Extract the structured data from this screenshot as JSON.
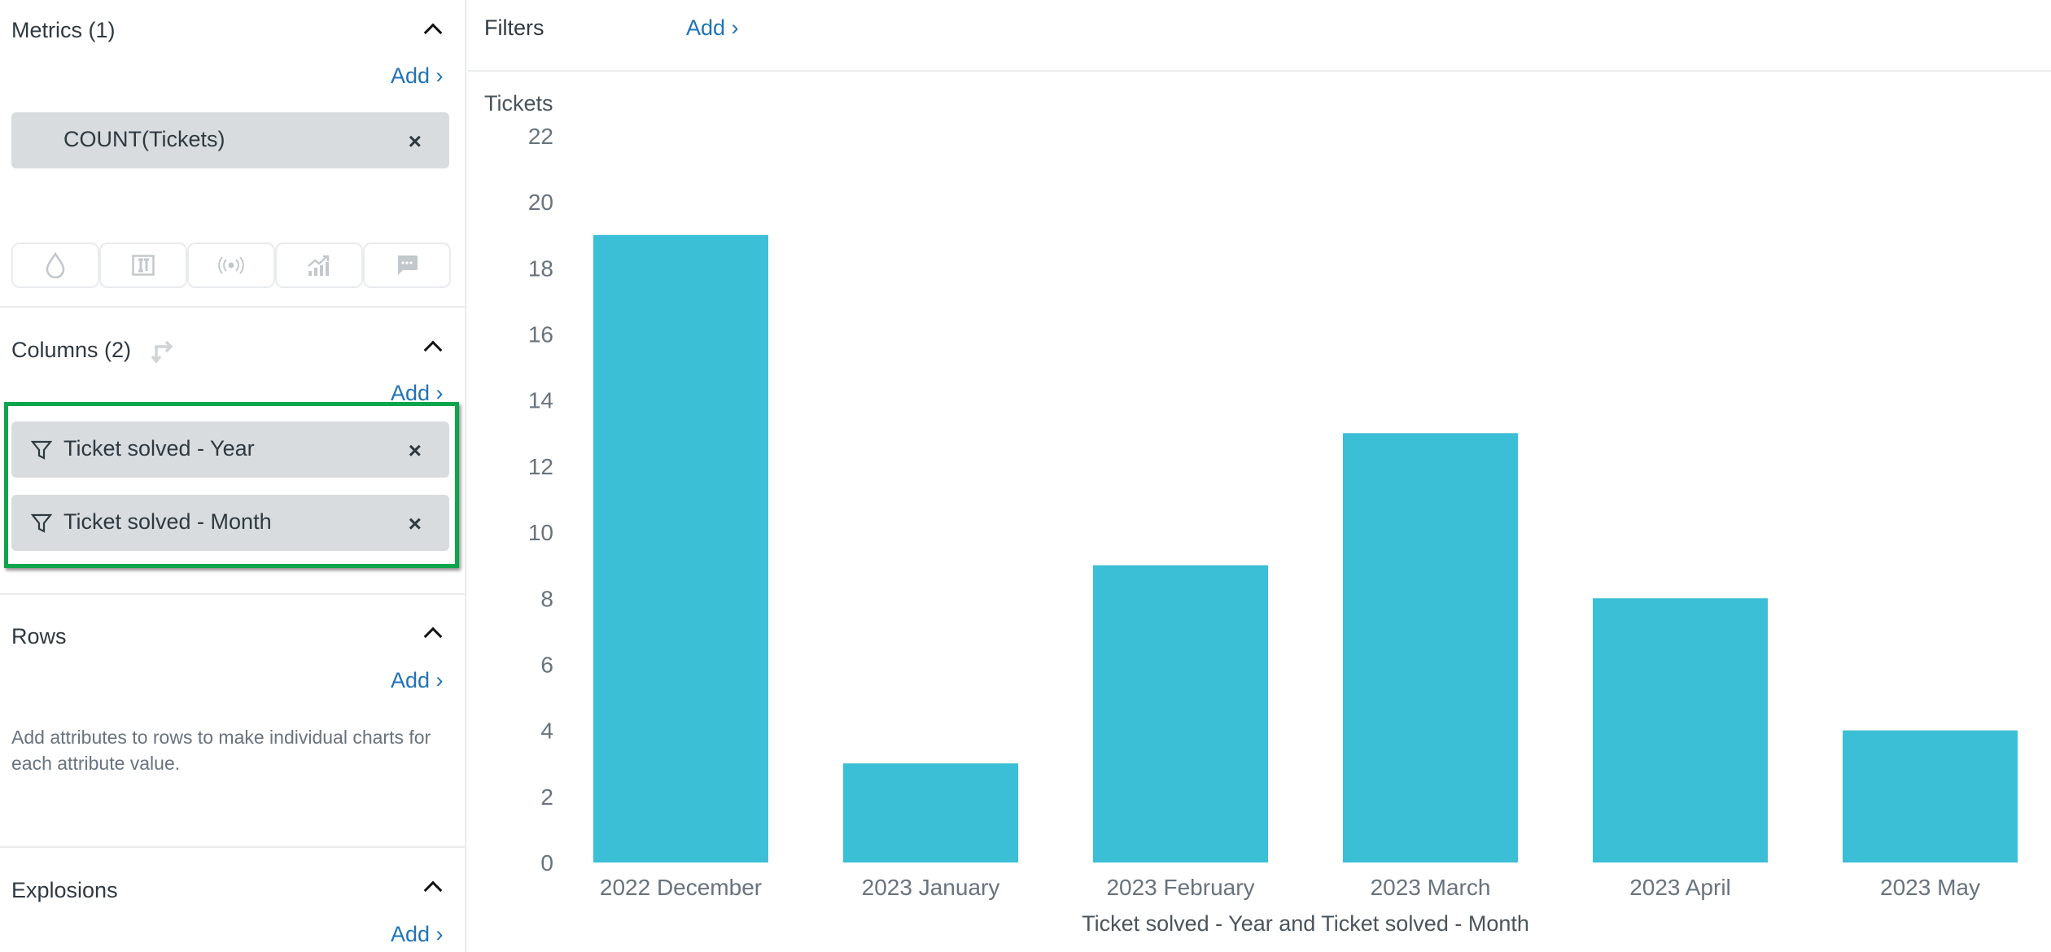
{
  "sidebar": {
    "metrics": {
      "title": "Metrics (1)",
      "add": "Add ›",
      "items": [
        {
          "label": "COUNT(Tickets)",
          "remove": "×"
        }
      ]
    },
    "viz_buttons": [
      "drop-icon",
      "table-icon",
      "broadcast-icon",
      "trend-chart-icon",
      "comment-icon"
    ],
    "columns": {
      "title": "Columns (2)",
      "add": "Add ›",
      "items": [
        {
          "label": "Ticket solved - Year",
          "remove": "×"
        },
        {
          "label": "Ticket solved - Month",
          "remove": "×"
        }
      ]
    },
    "rows": {
      "title": "Rows",
      "add": "Add ›",
      "help": "Add attributes to rows to make individual charts for each attribute value."
    },
    "explosions": {
      "title": "Explosions",
      "add": "Add ›"
    }
  },
  "filters": {
    "title": "Filters",
    "add": "Add ›"
  },
  "colors": {
    "bar": "#3bbfd6",
    "accent": "#1f73b7",
    "highlight": "#0ca44c"
  },
  "chart_data": {
    "type": "bar",
    "ylabel": "Tickets",
    "xlabel": "Ticket solved - Year and Ticket solved - Month",
    "categories": [
      "2022 December",
      "2023 January",
      "2023 February",
      "2023 March",
      "2023 April",
      "2023 May"
    ],
    "values": [
      19,
      3,
      9,
      13,
      8,
      4
    ],
    "ylim": [
      0,
      22
    ],
    "yticks": [
      0,
      2,
      4,
      6,
      8,
      10,
      12,
      14,
      16,
      18,
      20,
      22
    ],
    "grid": false,
    "legend": "none"
  }
}
